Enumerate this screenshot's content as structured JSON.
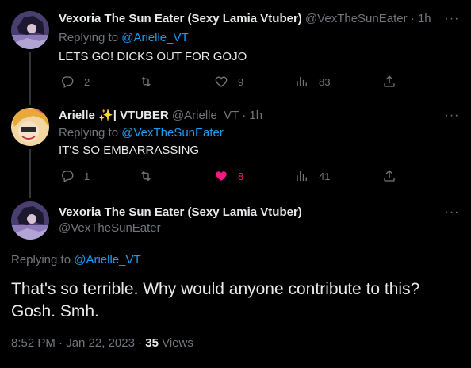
{
  "tweets": [
    {
      "name": "Vexoria The Sun Eater (Sexy Lamia Vtuber)",
      "handle": "@VexTheSunEater",
      "time": "1h",
      "replying_prefix": "Replying to",
      "replying_to": "@Arielle_VT",
      "text": "LETS GO! DICKS OUT FOR GOJO",
      "replies": "2",
      "retweets": "",
      "likes": "9",
      "views": "83"
    },
    {
      "name": "Arielle",
      "name_badge": "✨| VTUBER",
      "handle": "@Arielle_VT",
      "time": "1h",
      "replying_prefix": "Replying to",
      "replying_to": "@VexTheSunEater",
      "text": "IT'S SO EMBARRASSING",
      "replies": "1",
      "retweets": "",
      "likes": "8",
      "views": "41"
    }
  ],
  "main_tweet": {
    "name": "Vexoria The Sun Eater (Sexy Lamia Vtuber)",
    "handle": "@VexTheSunEater",
    "replying_prefix": "Replying to",
    "replying_to": "@Arielle_VT",
    "text": "That's so terrible. Why would anyone contribute to this? Gosh. Smh.",
    "timestamp": "8:52 PM · Jan 22, 2023 · ",
    "views_count": "35",
    "views_label": " Views"
  },
  "colors": {
    "background": "#000000",
    "text": "#e7e9ea",
    "muted": "#71767b",
    "link": "#1d9bf0",
    "like": "#f91880"
  },
  "icons": [
    "reply-icon",
    "retweet-icon",
    "heart-icon",
    "heart-filled-icon",
    "views-icon",
    "share-icon",
    "more-icon"
  ]
}
